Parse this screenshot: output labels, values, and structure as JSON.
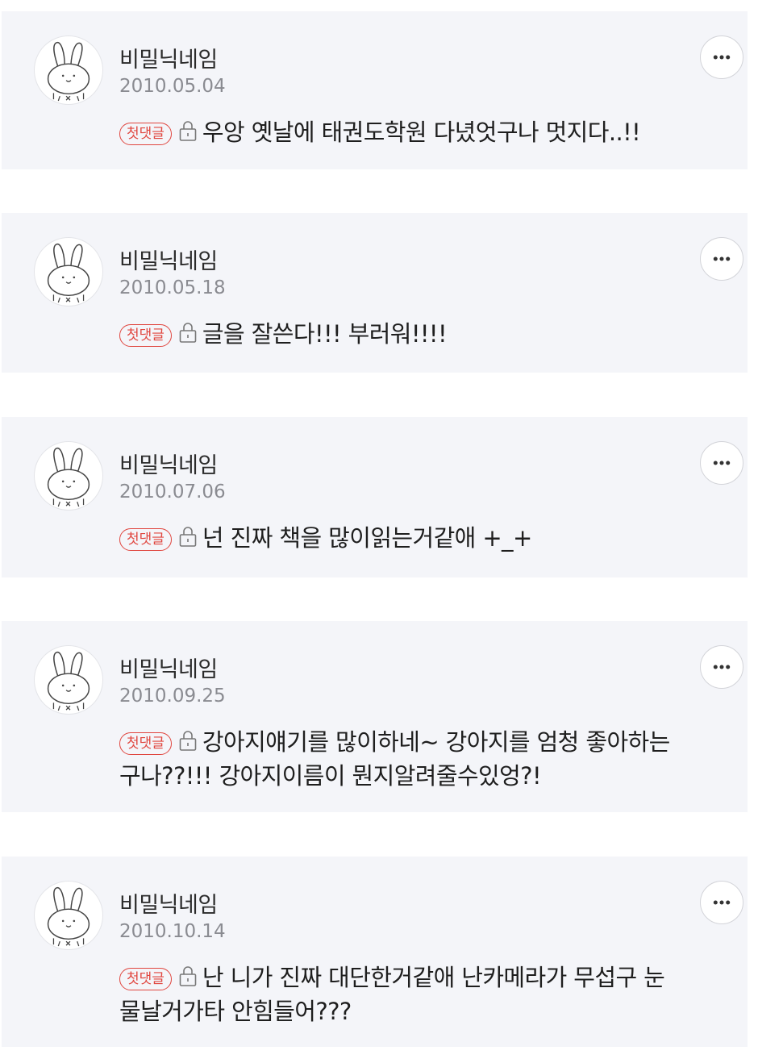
{
  "comments": [
    {
      "nickname": "비밀닉네임",
      "date": "2010.05.04",
      "badge": "첫댓글",
      "text": "우앙 옛날에 태권도학원 다녔엇구나 멋지다..!!"
    },
    {
      "nickname": "비밀닉네임",
      "date": "2010.05.18",
      "badge": "첫댓글",
      "text": "글을 잘쓴다!!! 부러워!!!!"
    },
    {
      "nickname": "비밀닉네임",
      "date": "2010.07.06",
      "badge": "첫댓글",
      "text": "넌 진짜 책을 많이읽는거같애 +_+"
    },
    {
      "nickname": "비밀닉네임",
      "date": "2010.09.25",
      "badge": "첫댓글",
      "text": "강아지얘기를 많이하네~ 강아지를 엄청 좋아하는구나??!!! 강아지이름이 뭔지알려줄수있엉?!"
    },
    {
      "nickname": "비밀닉네임",
      "date": "2010.10.14",
      "badge": "첫댓글",
      "text": "난 니가 진짜 대단한거같애 난카메라가 무섭구 눈물날거가타 안힘들어???"
    }
  ],
  "icons": {
    "avatar": "rabbit-avatar-icon",
    "more": "more-options-icon",
    "lock": "lock-icon"
  },
  "colors": {
    "card_background": "#f4f5f9",
    "badge": "#e0463f",
    "date_text": "#8a8b91"
  }
}
